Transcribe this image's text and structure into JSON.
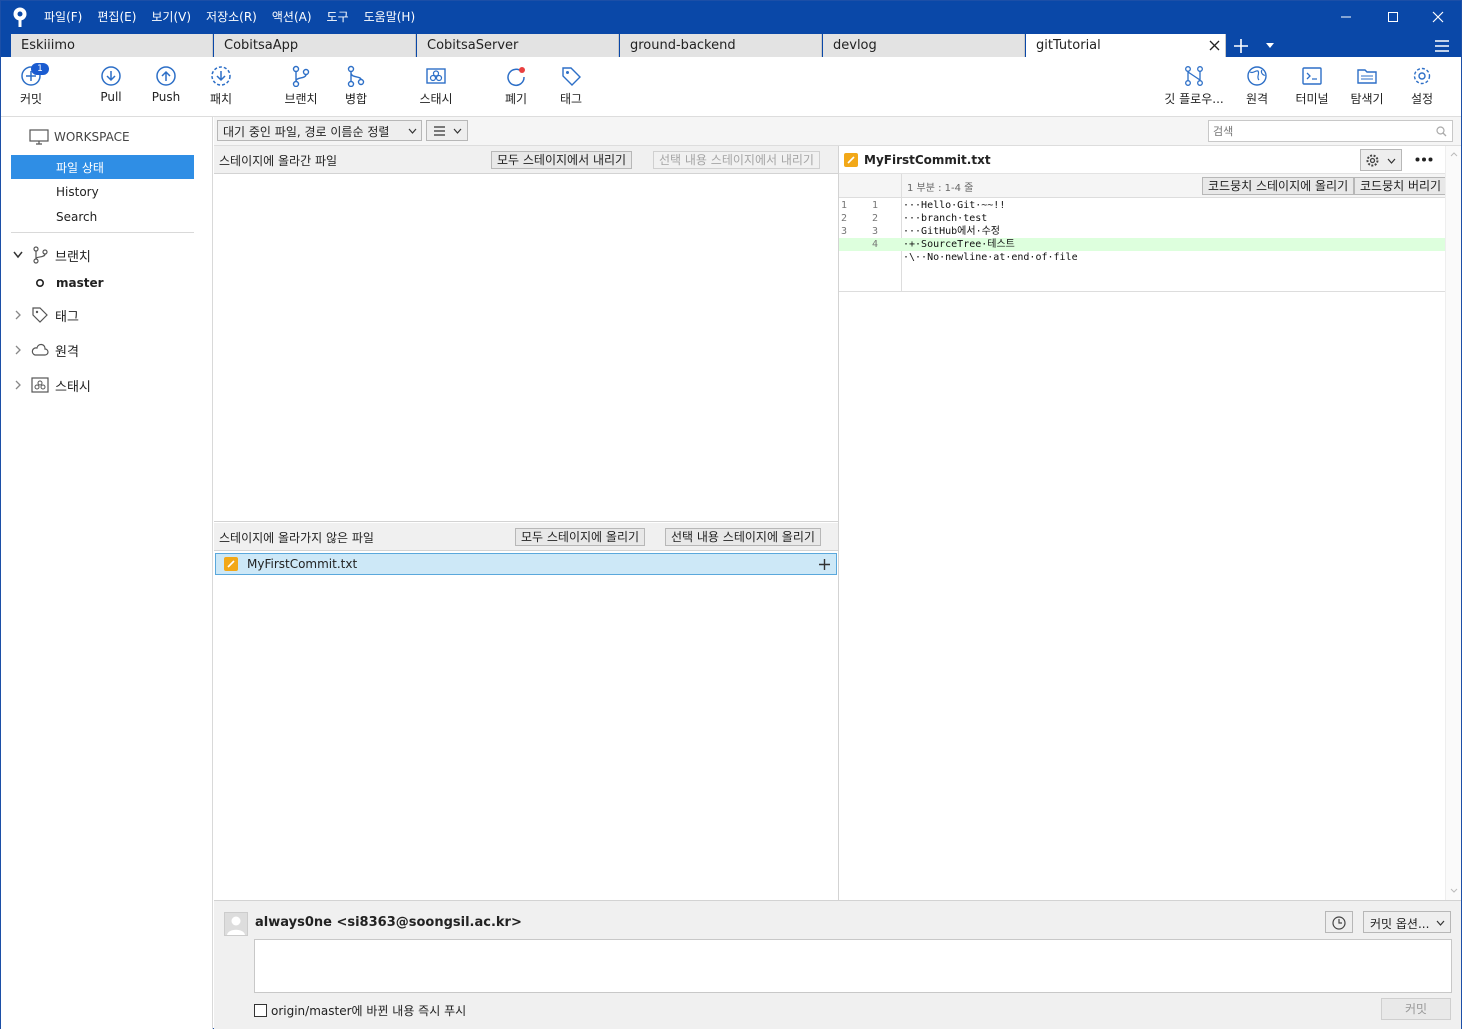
{
  "menu": [
    "파일(F)",
    "편집(E)",
    "보기(V)",
    "저장소(R)",
    "액션(A)",
    "도구",
    "도움말(H)"
  ],
  "tabs": [
    "Eskiiimo",
    "CobitsaApp",
    "CobitsaServer",
    "ground-backend",
    "devlog",
    "gitTutorial"
  ],
  "toolbar": {
    "commit": "커밋",
    "commit_badge": "1",
    "pull": "Pull",
    "push": "Push",
    "fetch": "패치",
    "branch": "브랜치",
    "merge": "병합",
    "stash": "스태시",
    "discard": "폐기",
    "tag": "태그",
    "gitflow": "깃 플로우...",
    "remote": "원격",
    "terminal": "터미널",
    "explorer": "탐색기",
    "settings": "설정"
  },
  "sidebar": {
    "workspace": "WORKSPACE",
    "file_status": "파일 상태",
    "history": "History",
    "search": "Search",
    "branches": "브랜치",
    "master": "master",
    "tags": "태그",
    "remotes": "원격",
    "stashes": "스태시"
  },
  "filter": {
    "sort": "대기 중인 파일, 경로 이름순 정렬",
    "search_placeholder": "검색"
  },
  "staged": {
    "title": "스테이지에 올라간 파일",
    "unstage_all": "모두 스테이지에서 내리기",
    "unstage_selected": "선택 내용 스테이지에서 내리기"
  },
  "unstaged": {
    "title": "스테이지에 올라가지 않은 파일",
    "stage_all": "모두 스테이지에 올리기",
    "stage_selected": "선택 내용 스테이지에 올리기",
    "files": [
      "MyFirstCommit.txt"
    ]
  },
  "diff": {
    "filename": "MyFirstCommit.txt",
    "hunk_header": "1 부분 : 1-4 줄",
    "stage_hunk": "코드뭉치 스테이지에 올리기",
    "discard_hunk": "코드뭉치 버리기",
    "lines": [
      {
        "old": "1",
        "new": "1",
        "text": "···Hello·Git·~~!!",
        "added": false
      },
      {
        "old": "2",
        "new": "2",
        "text": "···branch·test",
        "added": false
      },
      {
        "old": "3",
        "new": "3",
        "text": "···GitHub에서·수정",
        "added": false
      },
      {
        "old": "",
        "new": "4",
        "text": "·+·SourceTree·테스트",
        "added": true
      },
      {
        "old": "",
        "new": "",
        "text": "·\\··No·newline·at·end·of·file",
        "added": false
      }
    ]
  },
  "commit": {
    "author": "always0ne <si8363@soongsil.ac.kr>",
    "options": "커밋 옵션...",
    "push_label": "origin/master에 바뀐 내용 즉시 푸시",
    "commit_button": "커밋"
  },
  "colors": {
    "titlebar": "#0a48a8",
    "selection": "#2f8ee5",
    "row_highlight": "#cde8f7",
    "added_line": "#ddffdd",
    "modified_icon": "#f2a818"
  }
}
